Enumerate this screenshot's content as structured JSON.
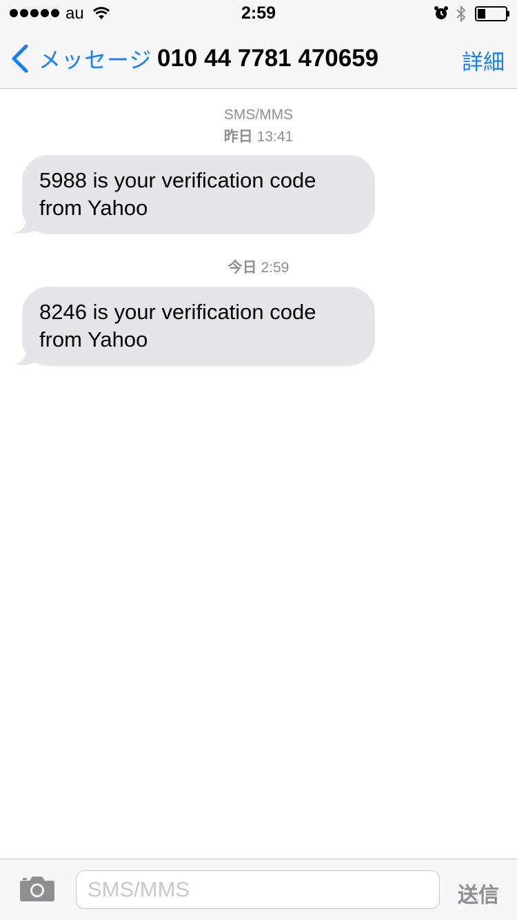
{
  "status_bar": {
    "carrier": "au",
    "time": "2:59",
    "icons": [
      "signal-dots",
      "wifi-icon",
      "alarm-icon",
      "bluetooth-icon",
      "battery-icon"
    ]
  },
  "nav": {
    "back_label": "メッセージ",
    "title": "010 44 7781 470659",
    "details_label": "詳細"
  },
  "thread": {
    "service_label": "SMS/MMS",
    "messages": [
      {
        "day": "昨日",
        "time": "13:41",
        "text": "5988 is your verification code from Yahoo"
      },
      {
        "day": "今日",
        "time": "2:59",
        "text": "8246 is your verification code from Yahoo"
      }
    ]
  },
  "composer": {
    "placeholder": "SMS/MMS",
    "value": "",
    "send_label": "送信",
    "camera_icon": "camera-icon"
  },
  "colors": {
    "accent": "#147efb",
    "bubble_incoming": "#e5e5ea",
    "bar_background": "#f7f7f7",
    "meta_text": "#8e8e93"
  }
}
